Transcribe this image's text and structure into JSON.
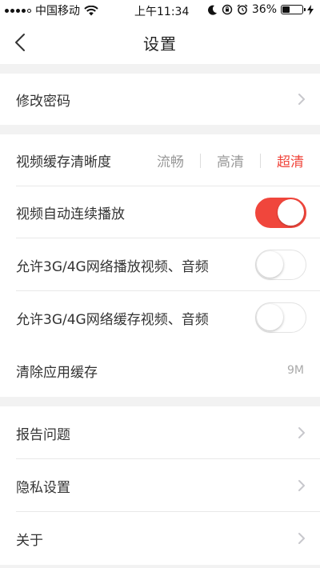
{
  "status_bar": {
    "carrier": "中国移动",
    "time": "上午11:34",
    "battery_percent": "36%",
    "battery_level": 0.36,
    "signal_icon": "signal-dots-icon",
    "wifi_icon": "wifi-icon",
    "moon_icon": "moon-icon",
    "lock_icon": "rotation-lock-icon",
    "alarm_icon": "alarm-icon",
    "charging_icon": "charging-bolt-icon"
  },
  "nav": {
    "title": "设置",
    "back_icon": "chevron-left-icon"
  },
  "settings": {
    "change_password": "修改密码",
    "video_quality": {
      "label": "视频缓存清晰度",
      "options": [
        "流畅",
        "高清",
        "超清"
      ],
      "selected": "超清"
    },
    "autoplay": {
      "label": "视频自动连续播放",
      "on": true
    },
    "mobile_play": {
      "label": "允许3G/4G网络播放视频、音频",
      "on": false
    },
    "mobile_cache": {
      "label": "允许3G/4G网络缓存视频、音频",
      "on": false
    },
    "clear_cache": {
      "label": "清除应用缓存",
      "size": "9M"
    },
    "report": "报告问题",
    "privacy": "隐私设置",
    "about": "关于"
  },
  "colors": {
    "accent": "#f0463c",
    "background": "#f2f2f2"
  }
}
